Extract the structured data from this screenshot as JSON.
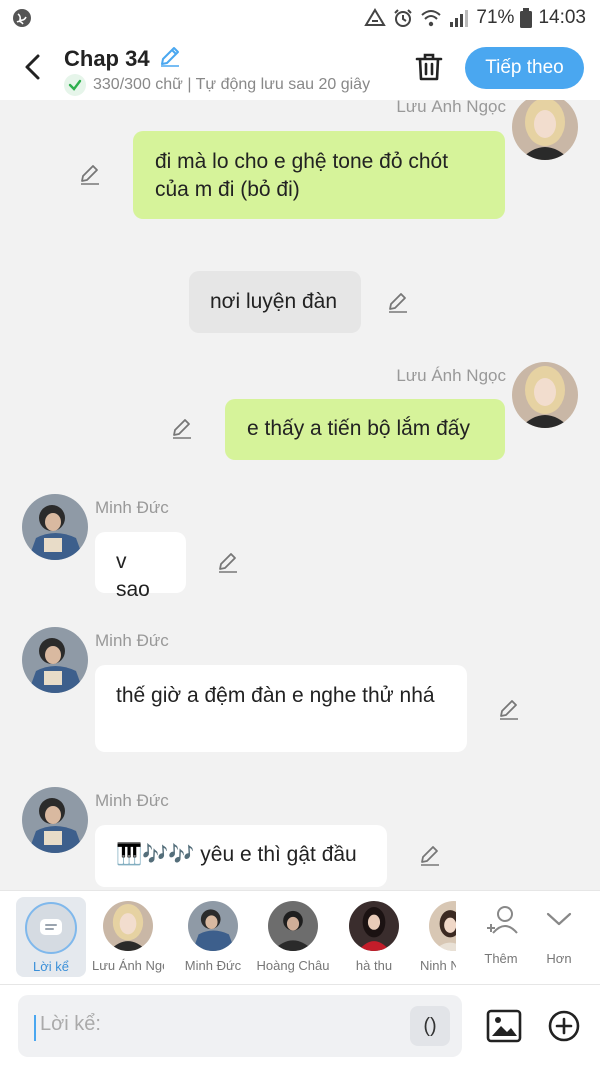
{
  "status_bar": {
    "battery": "71%",
    "time": "14:03"
  },
  "header": {
    "title": "Chap 34",
    "subtitle": "330/300 chữ | Tự động lưu sau 20 giây",
    "next_button": "Tiếp theo"
  },
  "messages": [
    {
      "type": "me",
      "sender": "Lưu Ánh Ngọc",
      "text": "đi mà lo cho e ghệ tone đỏ chót của m đi (bỏ đi)"
    },
    {
      "type": "narration",
      "text": "nơi luyện đàn"
    },
    {
      "type": "me",
      "sender": "Lưu Ánh Ngọc",
      "text": "e thấy a tiến bộ lắm đấy"
    },
    {
      "type": "other",
      "sender": "Minh Đức",
      "text": "v sao"
    },
    {
      "type": "other",
      "sender": "Minh Đức",
      "text": "thế giờ a đệm đàn e nghe thử nhá"
    },
    {
      "type": "other",
      "sender": "Minh Đức",
      "text": "🎹🎶🎶 yêu e thì gật đầu"
    }
  ],
  "characters": {
    "narrator_label": "Lời kể",
    "items": [
      {
        "label": "Lưu Ánh Ngọc"
      },
      {
        "label": "Minh Đức"
      },
      {
        "label": "Hoàng Châu"
      },
      {
        "label": "hà thu"
      },
      {
        "label": "Ninh Nhi"
      }
    ],
    "add_label": "Thêm",
    "more_label": "Hơn"
  },
  "input": {
    "placeholder": "Lời kể:",
    "paren_button": "()"
  },
  "colors": {
    "accent": "#4aa7f0",
    "my_bubble": "#d6f39a",
    "narration_bubble": "#e6e6e6",
    "other_bubble": "#ffffff"
  }
}
